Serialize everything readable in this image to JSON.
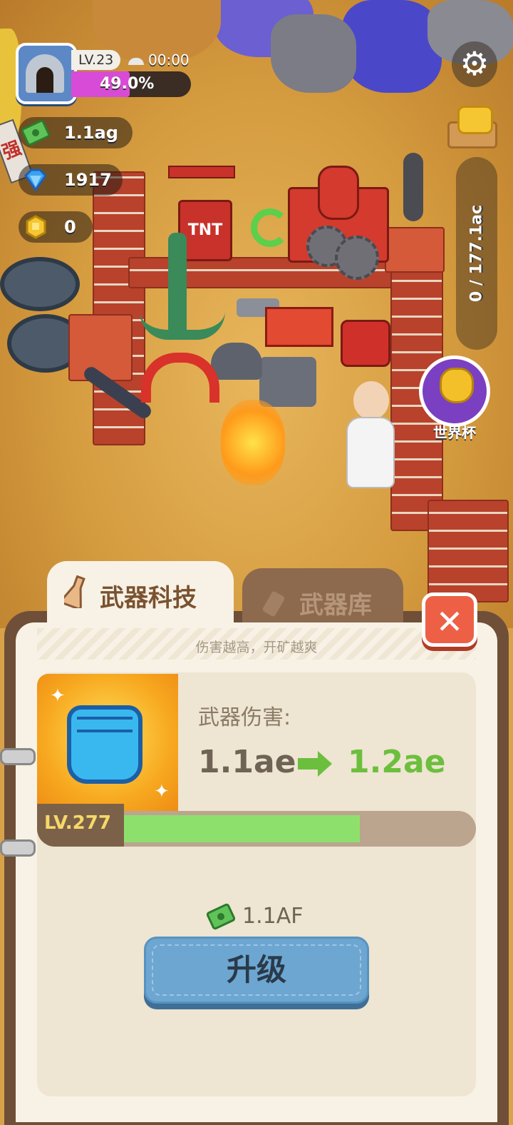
{
  "hud": {
    "level": "LV.23",
    "timer": "00:00",
    "progress_text": "49.0%",
    "progress_fraction": 0.49,
    "cash": "1.1ag",
    "gems": "1917",
    "gold": "0",
    "capacity": "0 / 177.1ac",
    "event_label": "世界杯"
  },
  "scene": {
    "tnt_label": "TNT",
    "side_sign": "强"
  },
  "tabs": [
    {
      "label": "武器科技",
      "active": true
    },
    {
      "label": "武器库",
      "active": false
    }
  ],
  "panel": {
    "subtitle": "伤害越高，开矿越爽",
    "stat_label": "武器伤害:",
    "current_value": "1.1ae",
    "next_value": "1.2ae",
    "level": "LV.277",
    "level_progress_fraction": 0.68,
    "cost": "1.1AF",
    "upgrade_label": "升级",
    "close_label": "✕"
  },
  "colors": {
    "accent_green": "#6cbf3d",
    "bar_fill": "#8de06c",
    "button_blue": "#6da6d1",
    "close_red": "#ee6046",
    "progress_magenta": "#d84bd6"
  }
}
